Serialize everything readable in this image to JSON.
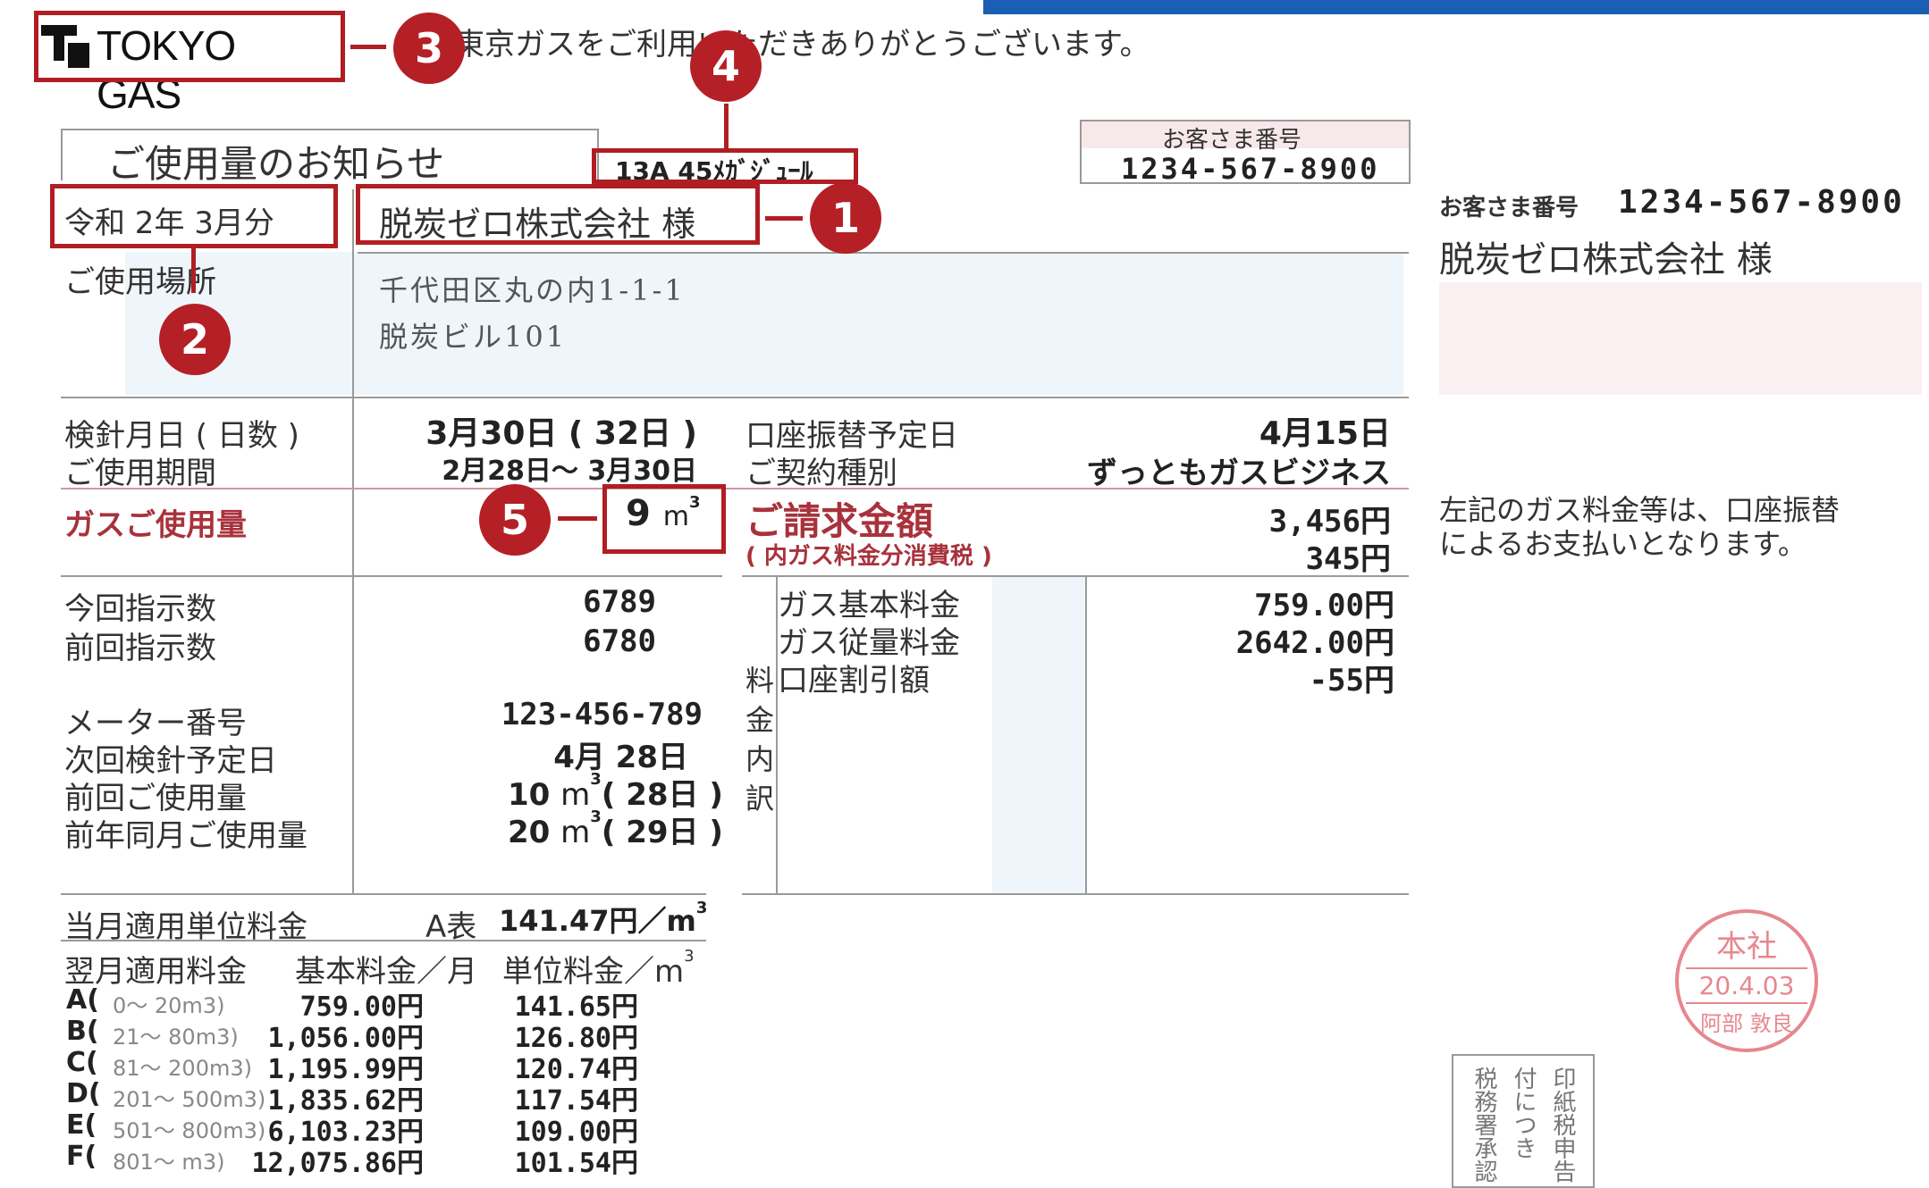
{
  "brand": {
    "logo_text": "TOKYO GAS",
    "greeting": "東京ガスをご利用いただきありがとうございます。"
  },
  "notice": {
    "title": "ご使用量のお知らせ",
    "gas_type": "13A 45ﾒｶﾞｼﾞｭｰﾙ",
    "customer_no_label": "お客さま番号",
    "customer_no": "1234-567-8900",
    "period": "令和 2年 3月分",
    "customer_name": "脱炭ゼロ株式会社 様",
    "usage_place_label": "ご使用場所",
    "address_line1": "千代田区丸の内1-1-1",
    "address_line2": "脱炭ビル101"
  },
  "meter": {
    "reading_date_label": "検針月日 ( 日数 )",
    "reading_date": "3月30日 ( 32日 )",
    "period_label": "ご使用期間",
    "period_value": "2月28日～ 3月30日",
    "usage_label": "ガスご使用量",
    "usage_value": "9",
    "usage_unit": "m",
    "current_label": "今回指示数",
    "current_value": "6789",
    "previous_label": "前回指示数",
    "previous_value": "6780",
    "meter_no_label": "メーター番号",
    "meter_no": "123-456-789",
    "next_date_label": "次回検針予定日",
    "next_date": "4月 28日",
    "prev_usage_label": "前回ご使用量",
    "prev_usage_num": "10",
    "prev_usage_days": "( 28日 )",
    "last_year_label": "前年同月ご使用量",
    "last_year_num": "20",
    "last_year_days": "( 29日 )",
    "unit": "m",
    "unit_sup": "3"
  },
  "billing": {
    "debit_date_label": "口座振替予定日",
    "debit_date": "4月15日",
    "contract_label": "ご契約種別",
    "contract_value": "ずっともガスビジネス",
    "amount_label": "ご請求金額",
    "amount": "3,456円",
    "tax_label": "( 内ガス料金分消費税 )",
    "tax": "345円",
    "breakdown_vertical": [
      "料",
      "金",
      "内",
      "訳"
    ],
    "items": [
      {
        "label": "ガス基本料金",
        "value": "759.00円"
      },
      {
        "label": "ガス従量料金",
        "value": "2642.00円"
      },
      {
        "label": "口座割引額",
        "value": "-55円"
      }
    ]
  },
  "rates": {
    "current_label": "当月適用単位料金",
    "current_table": "A表",
    "current_value": "141.47円／m",
    "next_label": "翌月適用料金",
    "base_header": "基本料金／月",
    "unit_header": "単位料金／m",
    "rows": [
      {
        "tier": "A(",
        "range": "0～  20m3)",
        "base": "759.00円",
        "unit": "141.65円"
      },
      {
        "tier": "B(",
        "range": "21～  80m3)",
        "base": "1,056.00円",
        "unit": "126.80円"
      },
      {
        "tier": "C(",
        "range": "81～ 200m3)",
        "base": "1,195.99円",
        "unit": "120.74円"
      },
      {
        "tier": "D(",
        "range": "201～ 500m3)",
        "base": "1,835.62円",
        "unit": "117.54円"
      },
      {
        "tier": "E(",
        "range": "501～ 800m3)",
        "base": "6,103.23円",
        "unit": "109.00円"
      },
      {
        "tier": "F(",
        "range": "801～     m3)",
        "base": "12,075.86円",
        "unit": "101.54円"
      }
    ]
  },
  "stub": {
    "customer_no_label": "お客さま番号",
    "customer_no": "1234-567-8900",
    "customer_name": "脱炭ゼロ株式会社 様",
    "payment_note_1": "左記のガス料金等は、口座振替",
    "payment_note_2": "によるお支払いとなります。",
    "stamp_top": "本社",
    "stamp_mid": "20.4.03",
    "stamp_bottom": "阿部 敦良",
    "tax_box_col1": "税務署承認",
    "tax_box_col2": "付につき",
    "tax_box_col3": "印紙税申告"
  },
  "badges": [
    "1",
    "2",
    "3",
    "4",
    "5"
  ],
  "colors": {
    "highlight": "#b01e24",
    "badge": "#b51f26",
    "blue_bar": "#1a5fb4",
    "stamp": "#e06a74"
  }
}
